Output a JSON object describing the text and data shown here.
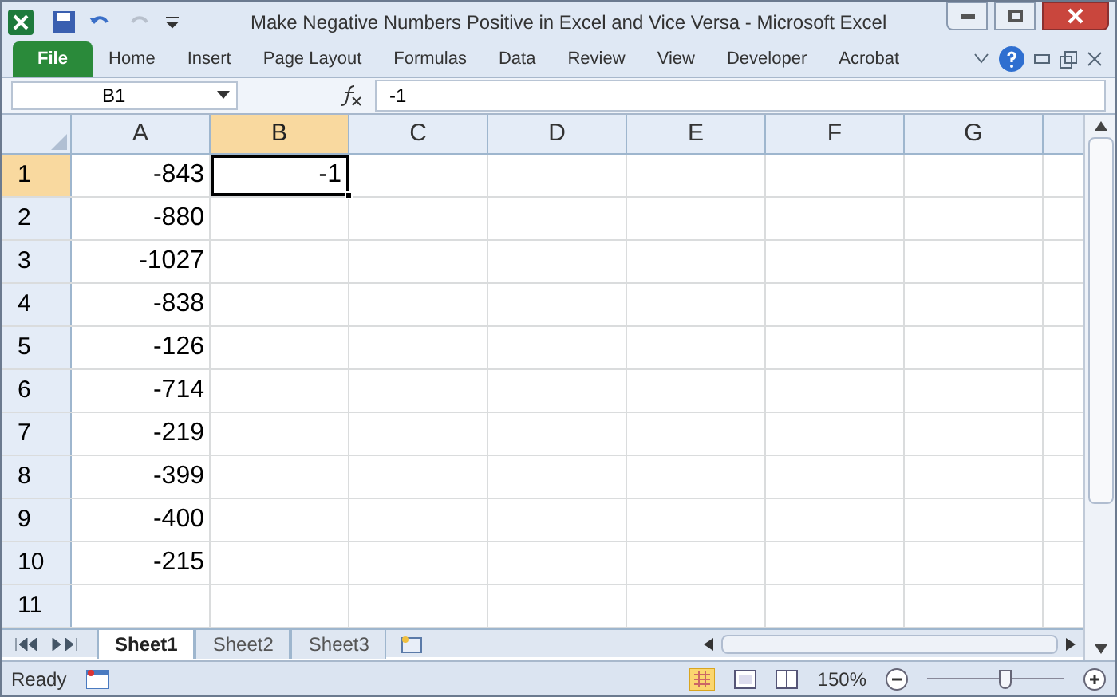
{
  "window": {
    "title": "Make Negative Numbers Positive in Excel and Vice Versa  -  Microsoft Excel"
  },
  "ribbon_tabs": [
    {
      "label": "File",
      "kind": "file"
    },
    {
      "label": "Home",
      "kind": "tab"
    },
    {
      "label": "Insert",
      "kind": "tab"
    },
    {
      "label": "Page Layout",
      "kind": "tab"
    },
    {
      "label": "Formulas",
      "kind": "tab"
    },
    {
      "label": "Data",
      "kind": "tab"
    },
    {
      "label": "Review",
      "kind": "tab"
    },
    {
      "label": "View",
      "kind": "tab"
    },
    {
      "label": "Developer",
      "kind": "tab"
    },
    {
      "label": "Acrobat",
      "kind": "tab"
    }
  ],
  "formula_bar": {
    "name_box": "B1",
    "formula": "-1"
  },
  "columns": [
    {
      "label": "A",
      "selected": false
    },
    {
      "label": "B",
      "selected": true
    },
    {
      "label": "C",
      "selected": false
    },
    {
      "label": "D",
      "selected": false
    },
    {
      "label": "E",
      "selected": false
    },
    {
      "label": "F",
      "selected": false
    },
    {
      "label": "G",
      "selected": false
    }
  ],
  "rows": [
    {
      "label": "1",
      "selected": true,
      "cells": [
        {
          "value": "-843",
          "selected": false
        },
        {
          "value": "-1",
          "selected": true
        }
      ]
    },
    {
      "label": "2",
      "selected": false,
      "cells": [
        {
          "value": "-880",
          "selected": false
        }
      ]
    },
    {
      "label": "3",
      "selected": false,
      "cells": [
        {
          "value": "-1027",
          "selected": false
        }
      ]
    },
    {
      "label": "4",
      "selected": false,
      "cells": [
        {
          "value": "-838",
          "selected": false
        }
      ]
    },
    {
      "label": "5",
      "selected": false,
      "cells": [
        {
          "value": "-126",
          "selected": false
        }
      ]
    },
    {
      "label": "6",
      "selected": false,
      "cells": [
        {
          "value": "-714",
          "selected": false
        }
      ]
    },
    {
      "label": "7",
      "selected": false,
      "cells": [
        {
          "value": "-219",
          "selected": false
        }
      ]
    },
    {
      "label": "8",
      "selected": false,
      "cells": [
        {
          "value": "-399",
          "selected": false
        }
      ]
    },
    {
      "label": "9",
      "selected": false,
      "cells": [
        {
          "value": "-400",
          "selected": false
        }
      ]
    },
    {
      "label": "10",
      "selected": false,
      "cells": [
        {
          "value": "-215",
          "selected": false
        }
      ]
    },
    {
      "label": "11",
      "selected": false
    }
  ],
  "sheet_tabs": [
    {
      "label": "Sheet1",
      "selected": true
    },
    {
      "label": "Sheet2",
      "selected": false
    },
    {
      "label": "Sheet3",
      "selected": false
    }
  ],
  "status_bar": {
    "status": "Ready",
    "zoom": "150%",
    "zoom_slider": {
      "level": 0.57
    }
  }
}
